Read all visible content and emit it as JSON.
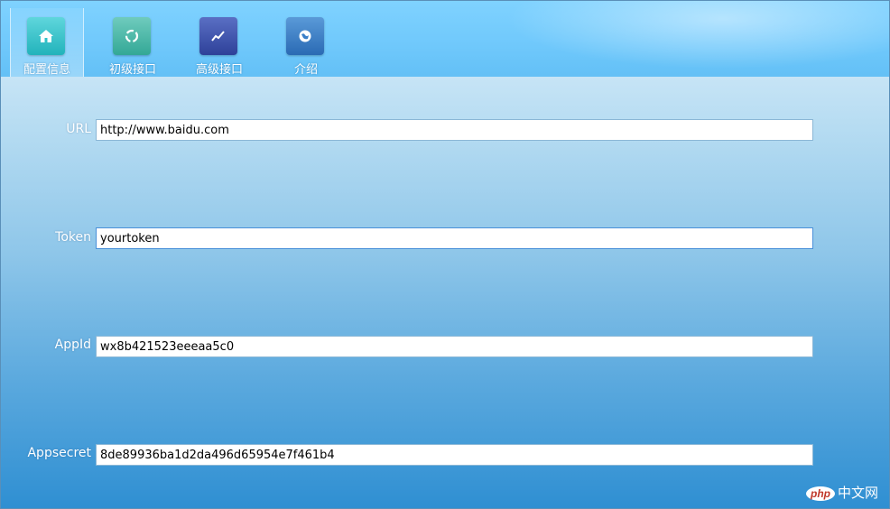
{
  "tabs": [
    {
      "label": "配置信息",
      "icon": "home-icon",
      "color": "#2fc1c8",
      "active": true
    },
    {
      "label": "初级接口",
      "icon": "refresh-icon",
      "color": "#3fb8a8",
      "active": false
    },
    {
      "label": "高级接口",
      "icon": "trend-icon",
      "color": "#3f56b0",
      "active": false
    },
    {
      "label": "介绍",
      "icon": "globe-icon",
      "color": "#3a7fc8",
      "active": false
    }
  ],
  "fields": {
    "url": {
      "label": "URL",
      "value": "http://www.baidu.com"
    },
    "token": {
      "label": "Token",
      "value": "yourtoken"
    },
    "appid": {
      "label": "AppId",
      "value": "wx8b421523eeeaa5c0"
    },
    "appsecret": {
      "label": "Appsecret",
      "value": "8de89936ba1d2da496d65954e7f461b4"
    }
  },
  "watermark": {
    "badge": "php",
    "text": "中文网"
  }
}
